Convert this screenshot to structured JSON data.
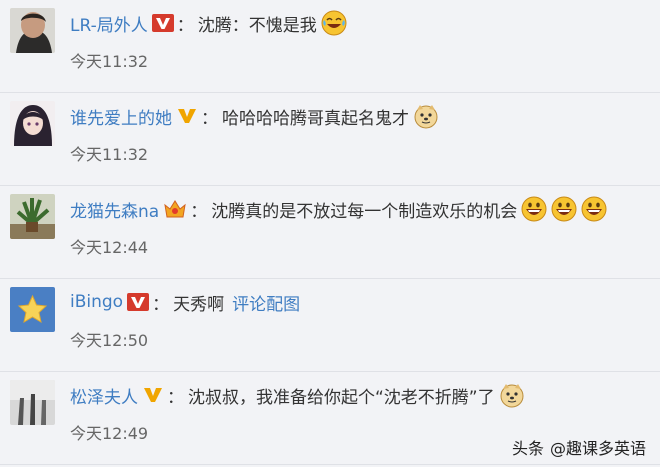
{
  "comments": [
    {
      "username": "LR-局外人",
      "badge": "v-red",
      "separator": "：",
      "text": "沈腾：不愧是我",
      "link": "",
      "emojis": [
        "laugh-tears-emoji"
      ],
      "time": "今天11:32"
    },
    {
      "username": "谁先爱上的她",
      "badge": "v-yellow",
      "separator": "：",
      "text": "哈哈哈哈腾哥真起名鬼才",
      "link": "",
      "emojis": [
        "doge-emoji"
      ],
      "time": "今天11:32"
    },
    {
      "username": "龙猫先森na",
      "badge": "crown",
      "separator": "：",
      "text": "沈腾真的是不放过每一个制造欢乐的机会",
      "link": "",
      "emojis": [
        "laugh-emoji",
        "laugh-emoji",
        "laugh-emoji"
      ],
      "time": "今天12:44"
    },
    {
      "username": "iBingo",
      "badge": "v-red",
      "separator": "：",
      "text": "天秀啊",
      "link": "评论配图",
      "emojis": [],
      "time": "今天12:50"
    },
    {
      "username": "松泽夫人",
      "badge": "v-yellow",
      "separator": "：",
      "text": "沈叔叔，我准备给你起个“沈老不折腾”了",
      "link": "",
      "emojis": [
        "doge-emoji"
      ],
      "time": "今天12:49"
    }
  ],
  "watermark": {
    "platform": "头条",
    "account": "@趣课多英语"
  },
  "colors": {
    "username": "#3f7dc2",
    "text": "#333333",
    "time": "#666666",
    "background": "#f2f3f6",
    "badge_red": "#d53a2c",
    "badge_yellow": "#f0a500"
  }
}
